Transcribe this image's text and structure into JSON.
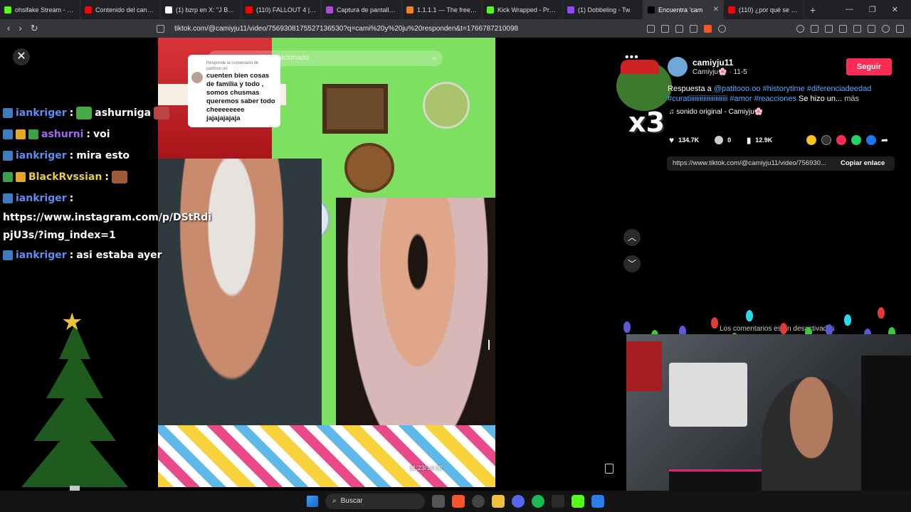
{
  "browser": {
    "tabs": [
      {
        "label": "ohsifake Stream - Wat",
        "color": "#53fc18",
        "active": false
      },
      {
        "label": "Contenido del canal -",
        "color": "#ff0000",
        "active": false
      },
      {
        "label": "(1) bzrp en X: \"J BALVI",
        "color": "#ffffff",
        "active": false
      },
      {
        "label": "(110) FALLOUT 4 | PRI",
        "color": "#ff0000",
        "active": false
      },
      {
        "label": "Captura de pantalla p",
        "color": "#b04bd8",
        "active": false
      },
      {
        "label": "1.1.1.1 — The free app",
        "color": "#f38020",
        "active": false
      },
      {
        "label": "Kick Wrapped - Proce",
        "color": "#53fc18",
        "active": false
      },
      {
        "label": "(1) Dobbeling - Tw",
        "color": "#9146ff",
        "active": false
      },
      {
        "label": "Encuentra 'cam",
        "color": "#000000",
        "active": true
      },
      {
        "label": "(110) ¿por qué se hace",
        "color": "#ff0000",
        "active": false
      }
    ],
    "url": "tiktok.com/@camiyju11/video/7569308175527136530?q=cami%20y%20ju%20responden&t=1766787210098"
  },
  "chat": {
    "messages": [
      {
        "user": "iankriger",
        "text": "ashurniga",
        "user_color": "blue"
      },
      {
        "user": "ashurni",
        "text": "voi",
        "user_color": "purple"
      },
      {
        "user": "iankriger",
        "text": "mira esto",
        "user_color": "blue"
      },
      {
        "user": "BlackRvssian",
        "text": "",
        "user_color": "gold"
      },
      {
        "user": "iankriger",
        "text": "https://www.instagram.com/p/DStRdipjU3s/?img_index=1",
        "user_color": "blue"
      },
      {
        "user": "iankriger",
        "text": "asi estaba ayer",
        "user_color": "blue"
      }
    ]
  },
  "video": {
    "search_placeholder": "Buscar contenido relacionado",
    "comment_reply_header": "Responde al comentario de patitooo.oo",
    "comment_text": "cuenten bien cosas de familia y todo , somos chusmas queremos saber todo cheeeeeeee jajajajajaja",
    "timecode": "11:23/14:12"
  },
  "post": {
    "username": "camiyju11",
    "display_name": "Camiyju🌸",
    "date": "11-5",
    "follow_label": "Seguir",
    "description_prefix": "Respuesta a",
    "mention": "@patitooo.oo",
    "hashtags": "#historytime #diferenciadeedad #curatiiiiiiiiiiiiiiiiiiiiii #amor #reacciones",
    "description_suffix": "Se hizo un...",
    "more_label": "más",
    "sound": "sonido original - Camiyju🌸",
    "likes": "134.7K",
    "comments": "0",
    "saves": "12.9K",
    "link": "https://www.tiktok.com/@camiyju11/video/756930...",
    "copy_link_label": "Copiar enlace",
    "comments_disabled": "Los comentarios están desactivados"
  },
  "overlay": {
    "x3_text": "x3"
  },
  "taskbar": {
    "search_label": "Buscar"
  }
}
